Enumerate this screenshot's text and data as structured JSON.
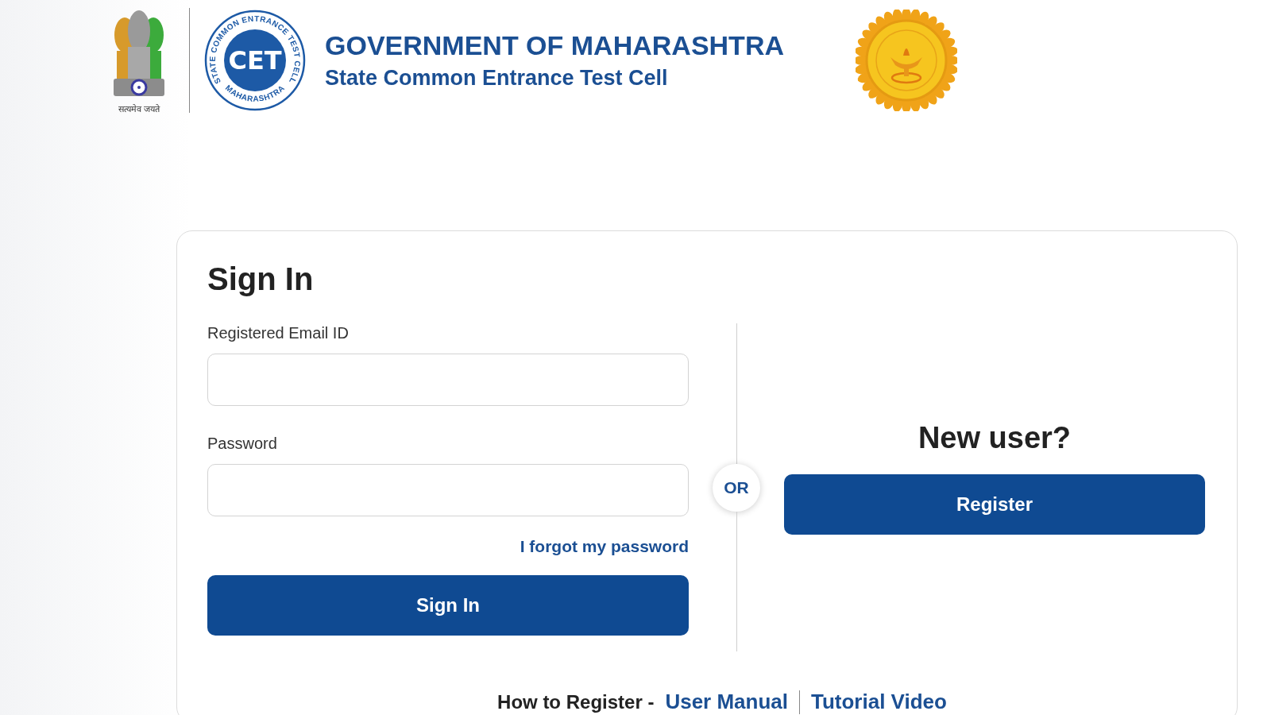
{
  "header": {
    "emblem_motto": "सत्यमेव जयते",
    "cet_logo": {
      "ring_text": "STATE COMMON ENTRANCE TEST CELL",
      "bottom_text": "MAHARASHTRA",
      "initials": "CET"
    },
    "title": "GOVERNMENT OF MAHARASHTRA",
    "subtitle": "State Common Entrance Test Cell"
  },
  "sign_in": {
    "heading": "Sign In",
    "fields": [
      {
        "label": "Registered Email ID"
      },
      {
        "label": "Password"
      }
    ],
    "forgot_link": "I forgot my password",
    "button": "Sign In"
  },
  "divider_label": "OR",
  "register": {
    "heading": "New user?",
    "button": "Register"
  },
  "help": {
    "label": "How to Register -",
    "links": [
      "User Manual",
      "Tutorial Video"
    ]
  }
}
